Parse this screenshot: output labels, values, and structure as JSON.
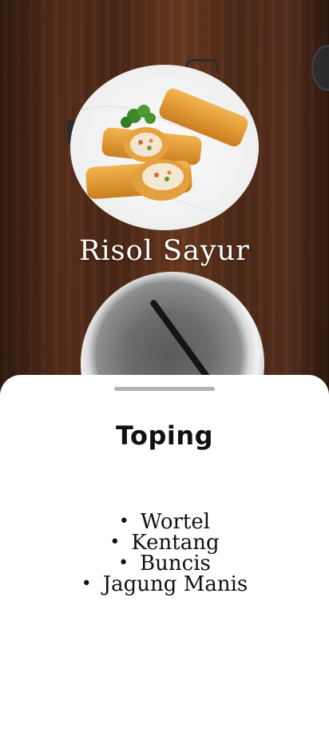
{
  "dish": {
    "name": "Risol Sayur",
    "photo_alt": "fried spring rolls"
  },
  "sheet": {
    "title": "Toping",
    "items": [
      {
        "label": "Wortel"
      },
      {
        "label": "Kentang"
      },
      {
        "label": "Buncis"
      },
      {
        "label": "Jagung Manis"
      }
    ]
  },
  "colors": {
    "sheet_bg": "#ffffff",
    "title_text": "#ffffff",
    "list_text": "#111111",
    "handle": "#b3b3b3"
  }
}
